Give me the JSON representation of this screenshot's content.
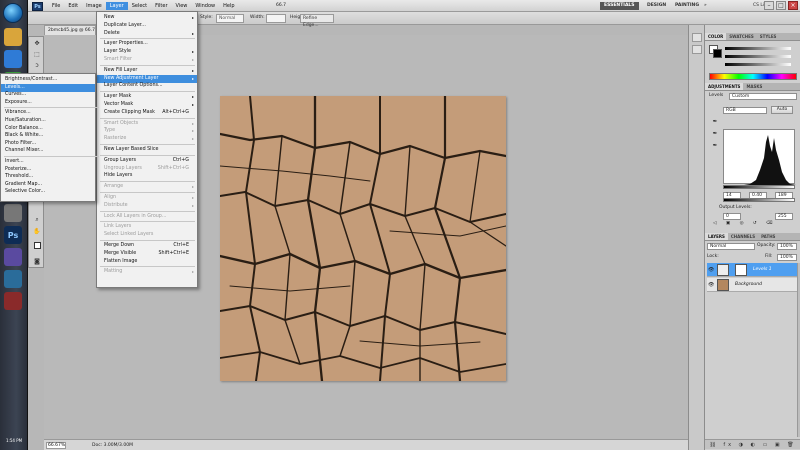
{
  "menubar": {
    "logo": "Ps",
    "items": [
      "File",
      "Edit",
      "Image",
      "Layer",
      "Select",
      "Filter",
      "View",
      "Window",
      "Help"
    ],
    "active_index": 3,
    "zoom_value": "66.7",
    "workspaces": [
      "ESSENTIALS",
      "DESIGN",
      "PAINTING"
    ],
    "more": "»",
    "cs_live": "CS Live ▾",
    "window_controls": [
      "–",
      "□",
      "×"
    ]
  },
  "options_bar": {
    "style_label": "Style:",
    "style_value": "Normal",
    "width_label": "Width:",
    "height_label": "Height:",
    "refine_edge": "Refine Edge..."
  },
  "document": {
    "tab_title": "2bmcb45.jpg @ 66.7% (Levels 1, Layer Mask/8)",
    "zoom": "66.67%",
    "doc_info": "Doc: 3.00M/3.00M"
  },
  "layer_menu": {
    "items": [
      {
        "label": "New",
        "arrow": true
      },
      {
        "label": "Duplicate Layer..."
      },
      {
        "label": "Delete",
        "arrow": true
      },
      {
        "sep": true
      },
      {
        "label": "Layer Properties..."
      },
      {
        "label": "Layer Style",
        "arrow": true
      },
      {
        "label": "Smart Filter",
        "arrow": true,
        "disabled": true
      },
      {
        "sep": true
      },
      {
        "label": "New Fill Layer",
        "arrow": true
      },
      {
        "label": "New Adjustment Layer",
        "arrow": true,
        "highlight": true
      },
      {
        "label": "Layer Content Options..."
      },
      {
        "sep": true
      },
      {
        "label": "Layer Mask",
        "arrow": true
      },
      {
        "label": "Vector Mask",
        "arrow": true
      },
      {
        "label": "Create Clipping Mask",
        "shortcut": "Alt+Ctrl+G"
      },
      {
        "sep": true
      },
      {
        "label": "Smart Objects",
        "arrow": true,
        "disabled": true
      },
      {
        "label": "Type",
        "arrow": true,
        "disabled": true
      },
      {
        "label": "Rasterize",
        "arrow": true,
        "disabled": true
      },
      {
        "sep": true
      },
      {
        "label": "New Layer Based Slice"
      },
      {
        "sep": true
      },
      {
        "label": "Group Layers",
        "shortcut": "Ctrl+G"
      },
      {
        "label": "Ungroup Layers",
        "shortcut": "Shift+Ctrl+G",
        "disabled": true
      },
      {
        "label": "Hide Layers"
      },
      {
        "sep": true
      },
      {
        "label": "Arrange",
        "arrow": true,
        "disabled": true
      },
      {
        "sep": true
      },
      {
        "label": "Align",
        "arrow": true,
        "disabled": true
      },
      {
        "label": "Distribute",
        "arrow": true,
        "disabled": true
      },
      {
        "sep": true
      },
      {
        "label": "Lock All Layers in Group...",
        "disabled": true
      },
      {
        "sep": true
      },
      {
        "label": "Link Layers",
        "disabled": true
      },
      {
        "label": "Select Linked Layers",
        "disabled": true
      },
      {
        "sep": true
      },
      {
        "label": "Merge Down",
        "shortcut": "Ctrl+E"
      },
      {
        "label": "Merge Visible",
        "shortcut": "Shift+Ctrl+E"
      },
      {
        "label": "Flatten Image"
      },
      {
        "sep": true
      },
      {
        "label": "Matting",
        "arrow": true,
        "disabled": true
      }
    ]
  },
  "adjustment_submenu": {
    "items": [
      {
        "label": "Brightness/Contrast..."
      },
      {
        "label": "Levels...",
        "highlight": true
      },
      {
        "label": "Curves..."
      },
      {
        "label": "Exposure..."
      },
      {
        "sep": true
      },
      {
        "label": "Vibrance..."
      },
      {
        "label": "Hue/Saturation..."
      },
      {
        "label": "Color Balance..."
      },
      {
        "label": "Black & White..."
      },
      {
        "label": "Photo Filter..."
      },
      {
        "label": "Channel Mixer..."
      },
      {
        "sep": true
      },
      {
        "label": "Invert..."
      },
      {
        "label": "Posterize..."
      },
      {
        "label": "Threshold..."
      },
      {
        "label": "Gradient Map..."
      },
      {
        "label": "Selective Color..."
      }
    ]
  },
  "color_panel": {
    "tabs": [
      "COLOR",
      "SWATCHES",
      "STYLES"
    ]
  },
  "adjustments_panel": {
    "tabs": [
      "ADJUSTMENTS",
      "MASKS"
    ],
    "title": "Levels",
    "preset": "Custom",
    "channel": "RGB",
    "auto": "Auto",
    "input_black": "14",
    "input_mid": "0.40",
    "input_white": "189",
    "output_label": "Output Levels:",
    "output_black": "0",
    "output_white": "255"
  },
  "layers_panel": {
    "tabs": [
      "LAYERS",
      "CHANNELS",
      "PATHS"
    ],
    "blend_mode": "Normal",
    "opacity_label": "Opacity:",
    "opacity": "100%",
    "lock_label": "Lock:",
    "fill_label": "Fill:",
    "fill": "100%",
    "layers": [
      {
        "name": "Levels 1",
        "selected": true
      },
      {
        "name": "Background",
        "selected": false
      }
    ],
    "footer_icons": "⛓ fx ◑ ◐ ▭ ▣ 🗑"
  },
  "taskbar": {
    "time": "1:54 PM"
  },
  "colors": {
    "highlight": "#3e8ede",
    "image": "#c39a77"
  }
}
